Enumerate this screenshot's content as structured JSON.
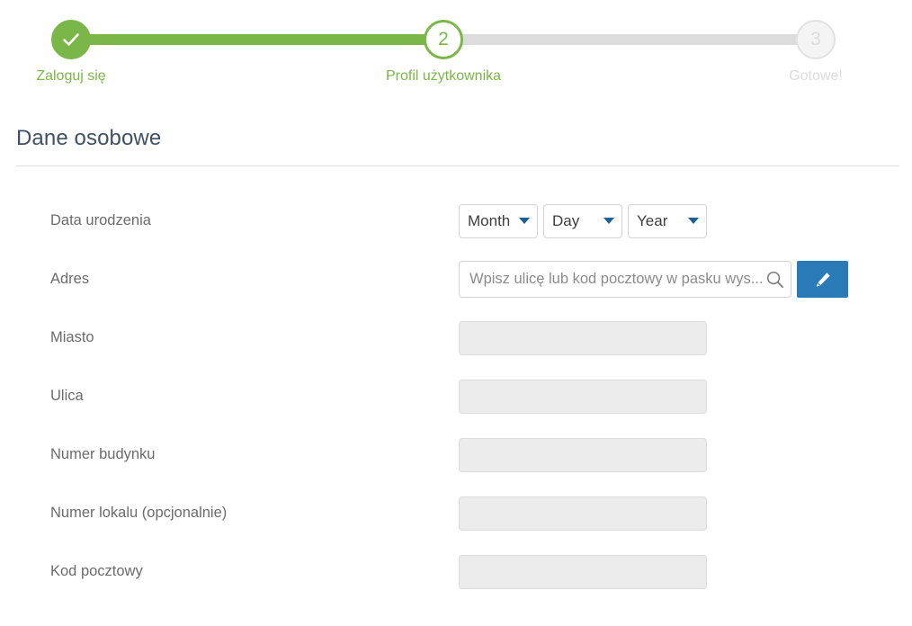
{
  "stepper": {
    "steps": [
      {
        "label": "Zaloguj się",
        "state": "done",
        "marker": "check-icon"
      },
      {
        "label": "Profil użytkownika",
        "state": "current",
        "marker": "2"
      },
      {
        "label": "Gotowe!",
        "state": "todo",
        "marker": "3"
      }
    ],
    "progress_percent": 50,
    "colors": {
      "active": "#7ab648",
      "inactive": "#dcdcdc"
    }
  },
  "section": {
    "title": "Dane osobowe"
  },
  "form": {
    "birthdate": {
      "label": "Data urodzenia",
      "month": {
        "value": "Month",
        "icon": "chevron-down-icon"
      },
      "day": {
        "value": "Day",
        "icon": "chevron-down-icon"
      },
      "year": {
        "value": "Year",
        "icon": "chevron-down-icon"
      }
    },
    "address": {
      "label": "Adres",
      "placeholder": "Wpisz ulicę lub kod pocztowy w pasku wys...",
      "value": "",
      "search_icon": "search-icon",
      "edit_button_icon": "pencil-icon",
      "edit_button_color": "#2a7ab8"
    },
    "fields": [
      {
        "label": "Miasto",
        "value": "",
        "placeholder": ""
      },
      {
        "label": "Ulica",
        "value": "",
        "placeholder": ""
      },
      {
        "label": "Numer budynku",
        "value": "",
        "placeholder": ""
      },
      {
        "label": "Numer lokalu (opcjonalnie)",
        "value": "",
        "placeholder": ""
      },
      {
        "label": "Kod pocztowy",
        "value": "",
        "placeholder": ""
      }
    ]
  }
}
